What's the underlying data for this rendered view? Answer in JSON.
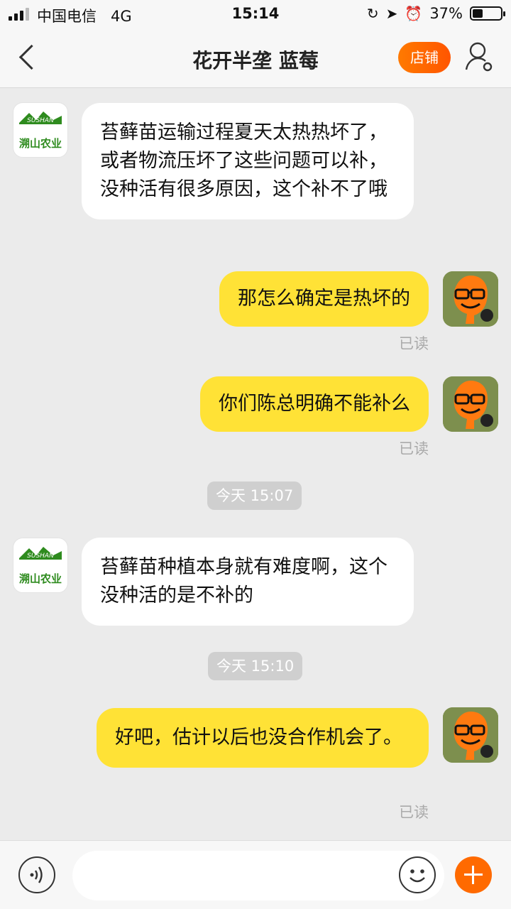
{
  "status_bar": {
    "carrier": "中国电信",
    "network": "4G",
    "time": "15:14",
    "battery": "37%",
    "battery_level": 0.37,
    "icons": [
      "signal-icon",
      "orientation-lock-icon",
      "location-icon",
      "alarm-icon",
      "battery-icon"
    ]
  },
  "header": {
    "title": "花开半垄 蓝莓",
    "shop_button": "店铺",
    "accent_color": "#ff6a00",
    "icons": [
      "back-chevron-icon",
      "profile-settings-icon"
    ]
  },
  "shop_logo": {
    "text": "溯山农业",
    "mark": "SUSHAN"
  },
  "messages": [
    {
      "from": "shop",
      "text": "苔藓苗运输过程夏天太热热坏了，或者物流压坏了这些问题可以补，没种活有很多原因，这个补不了哦"
    },
    {
      "from": "me",
      "text": "那怎么确定是热坏的",
      "status": "已读"
    },
    {
      "from": "me",
      "text": "你们陈总明确不能补么",
      "status": "已读"
    },
    {
      "type": "time",
      "text": "今天 15:07"
    },
    {
      "from": "shop",
      "text": "苔藓苗种植本身就有难度啊，这个没种活的是不补的"
    },
    {
      "type": "time",
      "text": "今天 15:10"
    },
    {
      "from": "me",
      "text": "好吧，估计以后也没合作机会了。",
      "status": "已读"
    }
  ],
  "input_bar": {
    "placeholder": "",
    "icons": [
      "voice-icon",
      "emoji-icon",
      "plus-icon"
    ]
  },
  "colors": {
    "my_bubble": "#ffe236",
    "their_bubble": "#ffffff",
    "background": "#ebebeb"
  }
}
